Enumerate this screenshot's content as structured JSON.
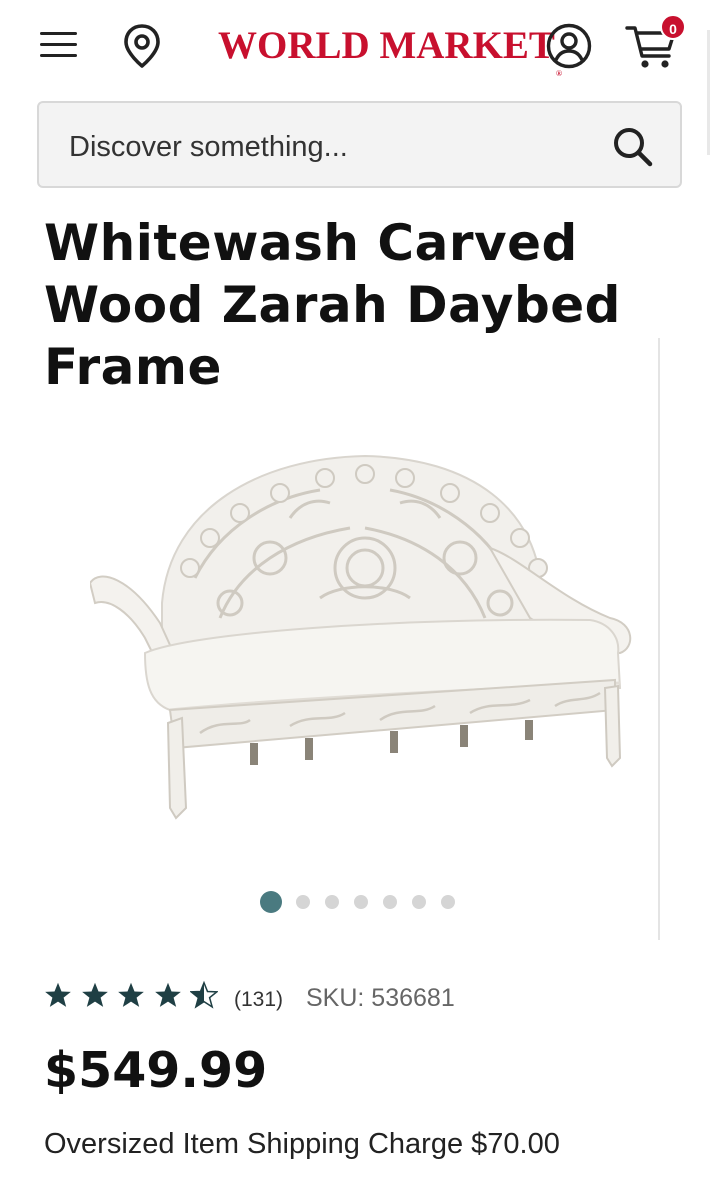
{
  "header": {
    "logo_main": "WORLD",
    "logo_second": "MARKET",
    "logo_reg": "®",
    "cart_count": "0",
    "brand_color": "#c8102e",
    "icons": [
      "menu-icon",
      "location-pin-icon",
      "account-icon",
      "cart-icon"
    ]
  },
  "search": {
    "placeholder": "Discover something..."
  },
  "product": {
    "title": "Whitewash Carved Wood Zarah Daybed Frame",
    "image_count": 7,
    "active_image_index": 0,
    "rating": 4.5,
    "rating_max": 5,
    "review_count": "(131)",
    "sku": "SKU: 536681",
    "price": "$549.99",
    "shipping_note": "Oversized Item Shipping Charge $70.00"
  },
  "colors": {
    "accent": "#4a7a80",
    "star": "#1f3f44",
    "dot_inactive": "#d5d5d5"
  }
}
